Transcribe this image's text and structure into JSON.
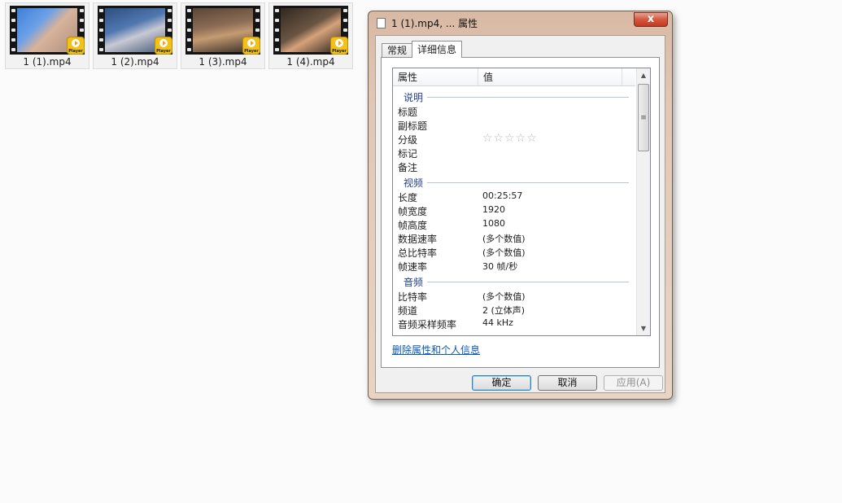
{
  "files": [
    {
      "name": "1 (1).mp4",
      "badge": "Player"
    },
    {
      "name": "1 (2).mp4",
      "badge": "Player"
    },
    {
      "name": "1 (3).mp4",
      "badge": "Player"
    },
    {
      "name": "1 (4).mp4",
      "badge": "Player"
    }
  ],
  "dialog": {
    "title": "1 (1).mp4, ... 属性",
    "close_label": "x",
    "tabs": [
      {
        "label": "常规",
        "active": false
      },
      {
        "label": "详细信息",
        "active": true
      }
    ],
    "columns": {
      "property": "属性",
      "value": "值"
    },
    "sections": {
      "description": {
        "title": "说明",
        "rows": [
          {
            "key": "标题",
            "value": ""
          },
          {
            "key": "副标题",
            "value": ""
          },
          {
            "key": "分级",
            "value": "☆☆☆☆☆"
          },
          {
            "key": "标记",
            "value": ""
          },
          {
            "key": "备注",
            "value": ""
          }
        ]
      },
      "video": {
        "title": "视频",
        "rows": [
          {
            "key": "长度",
            "value": "00:25:57"
          },
          {
            "key": "帧宽度",
            "value": "1920"
          },
          {
            "key": "帧高度",
            "value": "1080"
          },
          {
            "key": "数据速率",
            "value": "(多个数值)"
          },
          {
            "key": "总比特率",
            "value": "(多个数值)"
          },
          {
            "key": "帧速率",
            "value": "30 帧/秒"
          }
        ]
      },
      "audio": {
        "title": "音频",
        "rows": [
          {
            "key": "比特率",
            "value": "(多个数值)"
          },
          {
            "key": "频道",
            "value": "2 (立体声)"
          },
          {
            "key": "音频采样频率",
            "value": "44 kHz"
          }
        ]
      }
    },
    "rating_stars": 0,
    "remove_link": "删除属性和个人信息",
    "buttons": {
      "ok": "确定",
      "cancel": "取消",
      "apply": "应用(A)"
    }
  }
}
